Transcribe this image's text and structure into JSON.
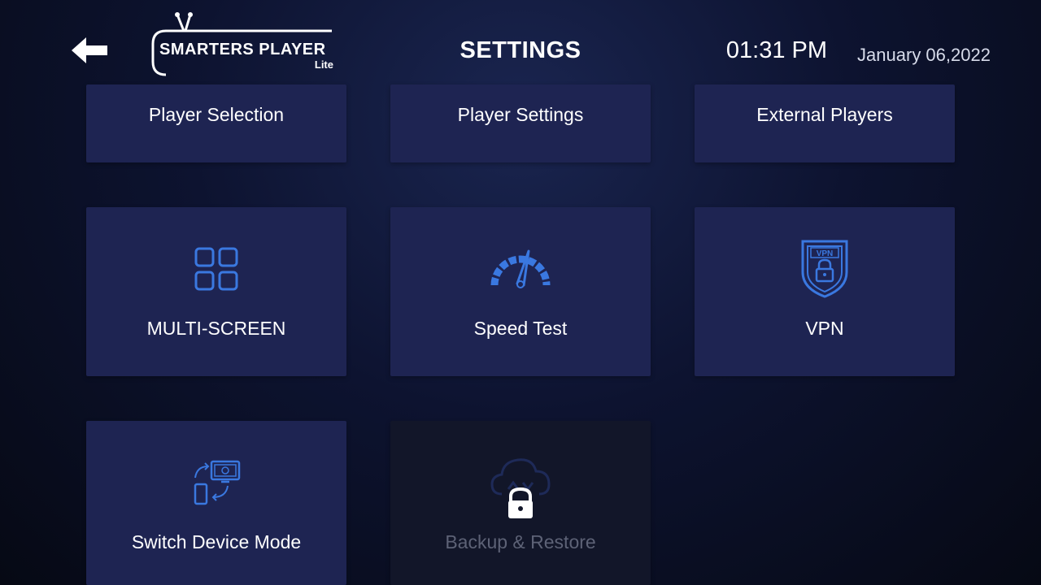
{
  "header": {
    "back_icon": "arrow-left-icon",
    "logo_text": "SMARTERS PLAYER",
    "logo_sub": "Lite",
    "title": "SETTINGS",
    "time": "01:31 PM",
    "date": "January 06,2022"
  },
  "tiles": [
    {
      "label": "Player Selection",
      "icon": "",
      "enabled": true
    },
    {
      "label": "Player Settings",
      "icon": "",
      "enabled": true
    },
    {
      "label": "External Players",
      "icon": "",
      "enabled": true
    },
    {
      "label": "MULTI-SCREEN",
      "icon": "multi-screen-grid-icon",
      "enabled": true
    },
    {
      "label": "Speed Test",
      "icon": "speedometer-icon",
      "enabled": true
    },
    {
      "label": "VPN",
      "icon": "vpn-shield-lock-icon",
      "enabled": true
    },
    {
      "label": "Switch Device Mode",
      "icon": "switch-device-icon",
      "enabled": true
    },
    {
      "label": "Backup & Restore",
      "icon": "cloud-lock-icon",
      "enabled": false
    }
  ],
  "vpn_badge_text": "VPN",
  "colors": {
    "accent": "#3a78e0",
    "tile": "#1e2452",
    "tile_disabled": "#121629"
  }
}
